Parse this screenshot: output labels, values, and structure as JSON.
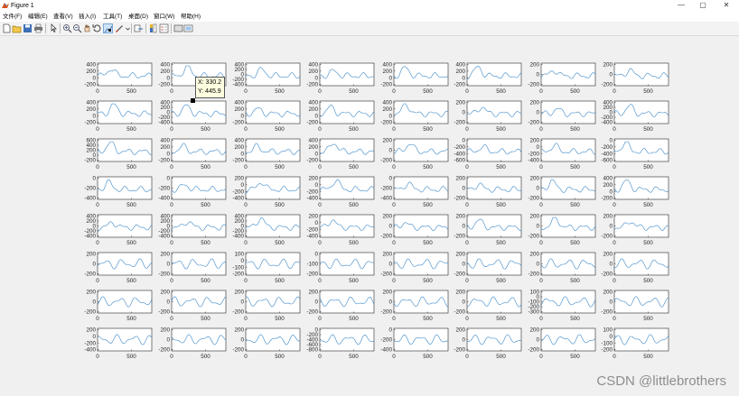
{
  "window": {
    "title": "Figure 1",
    "controls": {
      "minimize": "—",
      "maximize": "▢",
      "close": "✕"
    }
  },
  "menu": {
    "items": [
      "文件(F)",
      "编辑(E)",
      "查看(V)",
      "插入(I)",
      "工具(T)",
      "桌面(D)",
      "窗口(W)",
      "帮助(H)"
    ]
  },
  "toolbar": {
    "buttons": [
      "new-figure",
      "open-file",
      "save-figure",
      "print-figure",
      "edit-plot",
      "zoom-in",
      "zoom-out",
      "pan",
      "rotate-3d",
      "data-cursor",
      "brush",
      "link-plot",
      "insert-colorbar",
      "insert-legend",
      "hide-plot-tools",
      "show-plot-tools"
    ]
  },
  "datatip": {
    "x_label": "X: 330.2",
    "y_label": "Y: 445.9"
  },
  "line_color": "#3a87c8",
  "chart_data": {
    "type": "line",
    "layout": "8 rows x 8 columns of subplots",
    "xlim": [
      0,
      800
    ],
    "x_ticks": [
      "0",
      "500"
    ],
    "rows": [
      {
        "yticks": [
          [
            "400",
            "200",
            "0",
            "-200"
          ],
          [
            "400",
            "200",
            "0",
            "-200"
          ],
          [
            "400",
            "200",
            "0",
            "-200",
            "-400"
          ],
          [
            "400",
            "200",
            "0",
            "-200"
          ],
          [
            "400",
            "200",
            "0",
            "-200"
          ],
          [
            "400",
            "200",
            "0",
            "-200"
          ],
          [
            "200",
            "0",
            "-200"
          ],
          [
            "200",
            "0",
            "-200"
          ]
        ]
      },
      {
        "yticks": [
          [
            "400",
            "200",
            "0",
            "-200"
          ],
          [
            "400",
            "200",
            "0",
            "-200",
            "-400"
          ],
          [
            "400",
            "200",
            "0",
            "-200"
          ],
          [
            "400",
            "200",
            "0",
            "-200"
          ],
          [
            "400",
            "200",
            "0",
            "-200"
          ],
          [
            "200",
            "0",
            "-200"
          ],
          [
            "200",
            "0",
            "-200"
          ],
          [
            "400",
            "200",
            "0",
            "-200",
            "-400"
          ]
        ]
      },
      {
        "yticks": [
          [
            "600",
            "400",
            "200",
            "0",
            "-200"
          ],
          [
            "400",
            "200",
            "0",
            "-200"
          ],
          [
            "400",
            "200",
            "0",
            "-200"
          ],
          [
            "400",
            "200",
            "0",
            "-200"
          ],
          [
            "200",
            "0",
            "-200"
          ],
          [
            "0",
            "-200",
            "-400",
            "-600"
          ],
          [
            "200",
            "0",
            "-200",
            "-400"
          ],
          [
            "0",
            "-200",
            "-400",
            "-600"
          ]
        ]
      },
      {
        "yticks": [
          [
            "0",
            "-200",
            "-400"
          ],
          [
            "0",
            "-200",
            "-400"
          ],
          [
            "200",
            "0",
            "-200",
            "-400"
          ],
          [
            "200",
            "0",
            "-200",
            "-400"
          ],
          [
            "0",
            "-200",
            "-400"
          ],
          [
            "200",
            "0",
            "-200"
          ],
          [
            "200",
            "0",
            "-200"
          ],
          [
            "400",
            "200",
            "0",
            "-200"
          ]
        ]
      },
      {
        "yticks": [
          [
            "400",
            "200",
            "0",
            "-200",
            "-400"
          ],
          [
            "400",
            "200",
            "0",
            "-200",
            "-400"
          ],
          [
            "400",
            "200",
            "0",
            "-200",
            "-400"
          ],
          [
            "200",
            "0",
            "-200",
            "-400"
          ],
          [
            "200",
            "0",
            "-200"
          ],
          [
            "200",
            "0",
            "-200"
          ],
          [
            "200",
            "0",
            "-200"
          ],
          [
            "200",
            "0",
            "-200"
          ]
        ]
      },
      {
        "yticks": [
          [
            "200",
            "0",
            "-200"
          ],
          [
            "200",
            "0",
            "-200"
          ],
          [
            "100",
            "0",
            "-100",
            "-200"
          ],
          [
            "0",
            "-100",
            "-200"
          ],
          [
            "200",
            "0",
            "-200"
          ],
          [
            "200",
            "0",
            "-200"
          ],
          [
            "200",
            "0",
            "-200"
          ],
          [
            "200",
            "0",
            "-200"
          ]
        ]
      },
      {
        "yticks": [
          [
            "200",
            "0",
            "-200"
          ],
          [
            "200",
            "0",
            "-200"
          ],
          [
            "200",
            "0",
            "-200"
          ],
          [
            "200",
            "0",
            "-200"
          ],
          [
            "200",
            "0",
            "-200"
          ],
          [
            "200",
            "0",
            "-200"
          ],
          [
            "100",
            "0",
            "-100",
            "-200",
            "-300"
          ],
          [
            "200",
            "0",
            "-200"
          ]
        ]
      },
      {
        "yticks": [
          [
            "200",
            "0",
            "-200",
            "-400"
          ],
          [
            "200",
            "0",
            "-200"
          ],
          [
            "200",
            "0",
            "-200"
          ],
          [
            "0",
            "-200",
            "-400",
            "-600",
            "-800"
          ],
          [
            "0",
            "-200",
            "-400"
          ],
          [
            "200",
            "0",
            "-200"
          ],
          [
            "200",
            "0",
            "-200"
          ],
          [
            "100",
            "0",
            "-100",
            "-200"
          ]
        ]
      }
    ]
  },
  "watermark": "CSDN @littlebrothers"
}
